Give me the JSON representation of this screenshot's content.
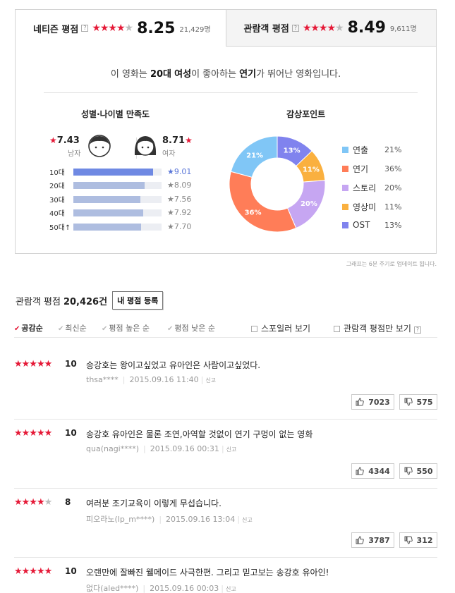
{
  "netizen": {
    "label": "네티즌 평점",
    "help": "?",
    "stars": 4,
    "score": "8.25",
    "count": "21,429명"
  },
  "audience": {
    "label": "관람객 평점",
    "help": "?",
    "stars": 4,
    "score": "8.49",
    "count": "9,611명"
  },
  "headline": {
    "pre": "이 영화는 ",
    "age": "20대",
    "sp": " ",
    "gender": "여성",
    "mid": "이 좋아하는 ",
    "point": "연기",
    "post": "가 뛰어난 영화입니다."
  },
  "satisfaction": {
    "title": "성별·나이별 만족도",
    "male": {
      "score": "7.43",
      "label": "남자"
    },
    "female": {
      "score": "8.71",
      "label": "여자"
    },
    "ages": [
      {
        "label": "10대",
        "score": "9.01",
        "value": 9.01,
        "highlight": true
      },
      {
        "label": "20대",
        "score": "8.09",
        "value": 8.09,
        "highlight": false
      },
      {
        "label": "30대",
        "score": "7.56",
        "value": 7.56,
        "highlight": false
      },
      {
        "label": "40대",
        "score": "7.92",
        "value": 7.92,
        "highlight": false
      },
      {
        "label": "50대↑",
        "score": "7.70",
        "value": 7.7,
        "highlight": false
      }
    ]
  },
  "points": {
    "title": "감상포인트",
    "items": [
      {
        "label": "연출",
        "pct": "21%",
        "value": 21,
        "color": "#80c6f6"
      },
      {
        "label": "연기",
        "pct": "36%",
        "value": 36,
        "color": "#ff7d58"
      },
      {
        "label": "스토리",
        "pct": "20%",
        "value": 20,
        "color": "#c6a6f2"
      },
      {
        "label": "영상미",
        "pct": "11%",
        "value": 11,
        "color": "#fab03f"
      },
      {
        "label": "OST",
        "pct": "13%",
        "value": 13,
        "color": "#8083ee"
      }
    ]
  },
  "update_note": "그래프는 6분 주기로 업데이트 됩니다.",
  "reviews_header": {
    "label": "관람객 평점",
    "count": "20,426건",
    "register": "내 평점 등록"
  },
  "sort": {
    "items": [
      {
        "label": "공감순",
        "active": true
      },
      {
        "label": "최신순",
        "active": false
      },
      {
        "label": "평점 높은 순",
        "active": false
      },
      {
        "label": "평점 낮은 순",
        "active": false
      }
    ],
    "spoiler": "스포일러 보기",
    "audience_only": "관람객 평점만 보기",
    "help": "?"
  },
  "reviews": [
    {
      "stars": 5,
      "score": "10",
      "text": "송강호는 왕이고싶었고 유아인은 사람이고싶었다.",
      "user": "thsa****",
      "date": "2015.09.16 11:40",
      "report": "신고",
      "likes": "7023",
      "dislikes": "575"
    },
    {
      "stars": 5,
      "score": "10",
      "text": "송강호 유아인은 물론 조연,아역할 것없이 연기 구멍이 없는 영화",
      "user": "qua(nagi****)",
      "date": "2015.09.16 00:31",
      "report": "신고",
      "likes": "4344",
      "dislikes": "550"
    },
    {
      "stars": 4,
      "score": "8",
      "text": "여러분 조기교육이 이렇게 무섭습니다.",
      "user": "피오라노(lp_m****)",
      "date": "2015.09.16 13:04",
      "report": "신고",
      "likes": "3787",
      "dislikes": "312"
    },
    {
      "stars": 5,
      "score": "10",
      "text": "오랜만에 잘빠진 웰메이드 사극한편. 그리고 믿고보는 송강호 유아인!",
      "user": "없다(aled****)",
      "date": "2015.09.16 00:03",
      "report": "신고",
      "likes": "",
      "dislikes": ""
    }
  ]
}
